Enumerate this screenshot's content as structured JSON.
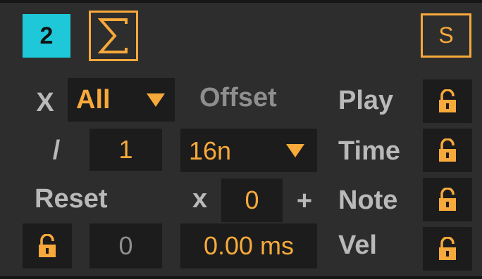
{
  "header": {
    "channel_number": "2",
    "solo_label": "S"
  },
  "row1": {
    "x_label": "X",
    "mode_value": "All",
    "offset_label": "Offset",
    "play_label": "Play"
  },
  "row2": {
    "divide_label": "/",
    "divisor_value": "1",
    "note_value": "16n",
    "time_label": "Time"
  },
  "row3": {
    "reset_label": "Reset",
    "multiply_label": "x",
    "multiplier_value": "0",
    "plus_label": "+",
    "note_label": "Note"
  },
  "row4": {
    "reset_value": "0",
    "ms_value": "0.00 ms",
    "vel_label": "Vel"
  },
  "colors": {
    "accent_orange": "#f7a93b",
    "accent_cyan": "#1ec8d8",
    "panel_bg": "#2d2d2d",
    "field_bg": "#1c1c1c"
  },
  "icons": {
    "sigma": "sigma-icon",
    "lock": "unlocked-padlock-icon",
    "dropdown": "triangle-down-icon"
  }
}
